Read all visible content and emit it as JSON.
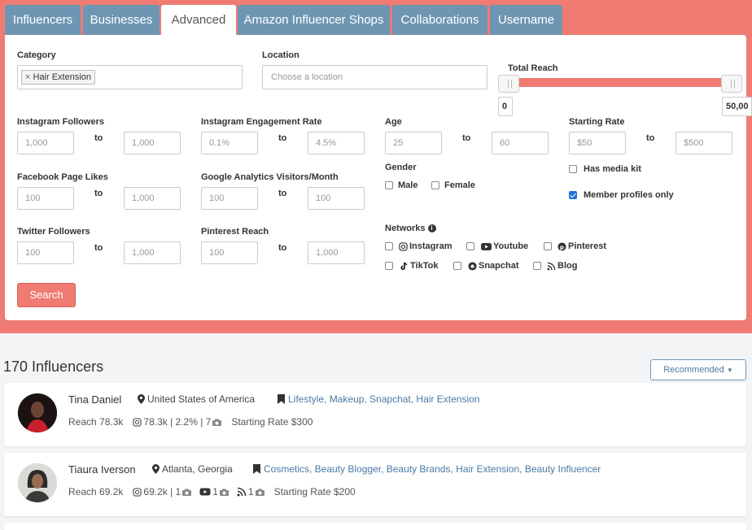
{
  "tabs": [
    {
      "label": "Influencers"
    },
    {
      "label": "Businesses"
    },
    {
      "label": "Advanced"
    },
    {
      "label": "Amazon Influencer Shops"
    },
    {
      "label": "Collaborations"
    },
    {
      "label": "Username"
    }
  ],
  "filters": {
    "category": {
      "label": "Category",
      "chip": "Hair Extension",
      "chip_remove": "×"
    },
    "location": {
      "label": "Location",
      "placeholder": "Choose a location"
    },
    "total_reach": {
      "label": "Total Reach",
      "min": "0",
      "max": "50,00"
    },
    "to_label": "to",
    "instagram_followers": {
      "label": "Instagram Followers",
      "min": "1,000",
      "max": "1,000"
    },
    "instagram_engagement": {
      "label": "Instagram Engagement Rate",
      "min": "0.1%",
      "max": "4.5%"
    },
    "age": {
      "label": "Age",
      "min": "25",
      "max": "60"
    },
    "starting_rate": {
      "label": "Starting Rate",
      "min": "$50",
      "max": "$500"
    },
    "facebook_likes": {
      "label": "Facebook Page Likes",
      "min": "100",
      "max": "1,000"
    },
    "google_analytics": {
      "label": "Google Analytics Visitors/Month",
      "min": "100",
      "max": "100"
    },
    "gender": {
      "label": "Gender",
      "male": "Male",
      "female": "Female"
    },
    "has_media_kit": {
      "label": "Has media kit",
      "checked": false
    },
    "member_profiles": {
      "label": "Member profiles only",
      "checked": true
    },
    "twitter_followers": {
      "label": "Twitter Followers",
      "min": "100",
      "max": "1,000"
    },
    "pinterest_reach": {
      "label": "Pinterest Reach",
      "min": "100",
      "max": "1,000"
    },
    "networks": {
      "label": "Networks",
      "items": [
        "Instagram",
        "Youtube",
        "Pinterest",
        "TikTok",
        "Snapchat",
        "Blog"
      ]
    },
    "search_button": "Search"
  },
  "results": {
    "count_label": "170 Influencers",
    "sort_label": "Recommended",
    "items": [
      {
        "name": "Tina Daniel",
        "location": "United States of America",
        "categories": "Lifestyle, Makeup, Snapchat, Hair Extension",
        "reach": "Reach 78.3k",
        "stats": "78.3k | 2.2% | 7",
        "rate": "Starting Rate $300"
      },
      {
        "name": "Tiaura Iverson",
        "location": "Atlanta, Georgia",
        "categories": "Cosmetics, Beauty Blogger, Beauty Brands, Hair Extension, Beauty Influencer",
        "reach": "Reach 69.2k",
        "ig": "69.2k | 1",
        "yt": "1",
        "blog": "1",
        "rate": "Starting Rate $200"
      }
    ]
  },
  "colors": {
    "accent": "#ef7b73",
    "tab": "#6e96b3",
    "link": "#4a7aa5",
    "checkbox": "#1f73d4"
  }
}
